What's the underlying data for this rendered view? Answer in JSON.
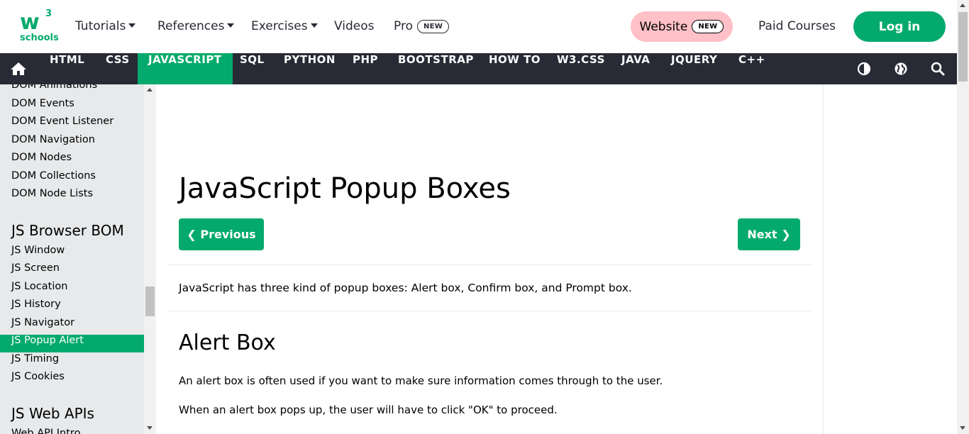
{
  "header": {
    "logo": {
      "mark": "w",
      "superscript": "3",
      "wordmark": "schools"
    },
    "nav": [
      {
        "label": "Tutorials",
        "dropdown": true
      },
      {
        "label": "References",
        "dropdown": true
      },
      {
        "label": "Exercises",
        "dropdown": true
      },
      {
        "label": "Videos",
        "dropdown": false
      },
      {
        "label": "Pro",
        "badge": "NEW"
      }
    ],
    "website_label": "Website",
    "website_badge": "NEW",
    "paid_courses": "Paid Courses",
    "login": "Log in"
  },
  "darknav": {
    "home_icon": "home-icon",
    "links": [
      "HTML",
      "CSS",
      "JAVASCRIPT",
      "SQL",
      "PYTHON",
      "PHP",
      "BOOTSTRAP",
      "HOW TO",
      "W3.CSS",
      "JAVA",
      "JQUERY",
      "C++"
    ],
    "active": "JAVASCRIPT",
    "icons": [
      "contrast-icon",
      "globe-icon",
      "search-icon"
    ]
  },
  "sidebar": {
    "dom_items": [
      "DOM Animations",
      "DOM Events",
      "DOM Event Listener",
      "DOM Navigation",
      "DOM Nodes",
      "DOM Collections",
      "DOM Node Lists"
    ],
    "bom_heading": "JS Browser BOM",
    "bom_items": [
      "JS Window",
      "JS Screen",
      "JS Location",
      "JS History",
      "JS Navigator",
      "JS Popup Alert",
      "JS Timing",
      "JS Cookies"
    ],
    "active": "JS Popup Alert",
    "webapi_heading": "JS Web APIs",
    "partial_item": "Web API Intro"
  },
  "main": {
    "title": "JavaScript Popup Boxes",
    "prev_label": "❮ Previous",
    "next_label": "Next ❯",
    "intro": "JavaScript has three kind of popup boxes: Alert box, Confirm box, and Prompt box.",
    "section_title": "Alert Box",
    "para1": "An alert box is often used if you want to make sure information comes through to the user.",
    "para2": "When an alert box pops up, the user will have to click \"OK\" to proceed."
  },
  "colors": {
    "brand_green": "#04AA6D",
    "nav_dark": "#282A35",
    "sidebar_bg": "#E7E9EB",
    "website_pink": "#FFC0C7"
  }
}
